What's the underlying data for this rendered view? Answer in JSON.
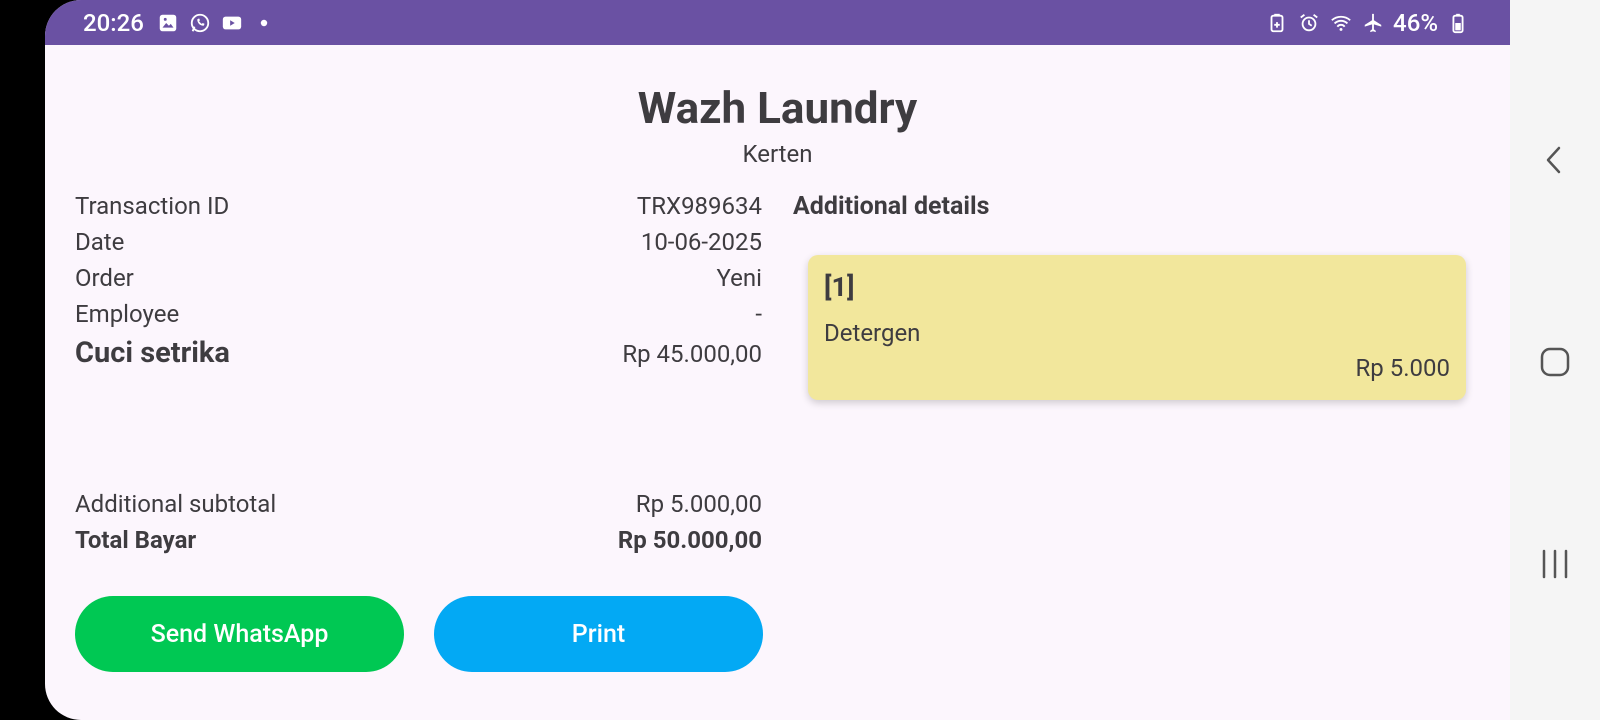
{
  "status_bar": {
    "time": "20:26",
    "battery": "46%",
    "left_icons": [
      "gallery-icon",
      "whatsapp-icon",
      "youtube-icon",
      "dot-icon"
    ],
    "right_icons": [
      "battery-saver-icon",
      "alarm-icon",
      "wifi-icon",
      "airplane-icon",
      "battery-icon"
    ],
    "color": "#6a51a3"
  },
  "header": {
    "title": "Wazh Laundry",
    "subtitle": "Kerten"
  },
  "details": {
    "transaction_id_label": "Transaction ID",
    "transaction_id_value": "TRX989634",
    "date_label": "Date",
    "date_value": "10-06-2025",
    "order_label": "Order",
    "order_value": "Yeni",
    "employee_label": "Employee",
    "employee_value": "-",
    "service_label": "Cuci setrika",
    "service_value": "Rp 45.000,00"
  },
  "totals": {
    "additional_label": "Additional subtotal",
    "additional_value": "Rp 5.000,00",
    "total_label": "Total Bayar",
    "total_value": "Rp 50.000,00"
  },
  "additional": {
    "title": "Additional details",
    "items": [
      {
        "index": "[1]",
        "name": "Detergen",
        "price": "Rp 5.000"
      }
    ],
    "card_color": "#f2e79c"
  },
  "buttons": {
    "whatsapp": "Send WhatsApp",
    "print": "Print",
    "whatsapp_color": "#00c853",
    "print_color": "#03a9f4"
  },
  "nav": {
    "icons": [
      "back-icon",
      "home-icon",
      "recents-icon"
    ]
  }
}
